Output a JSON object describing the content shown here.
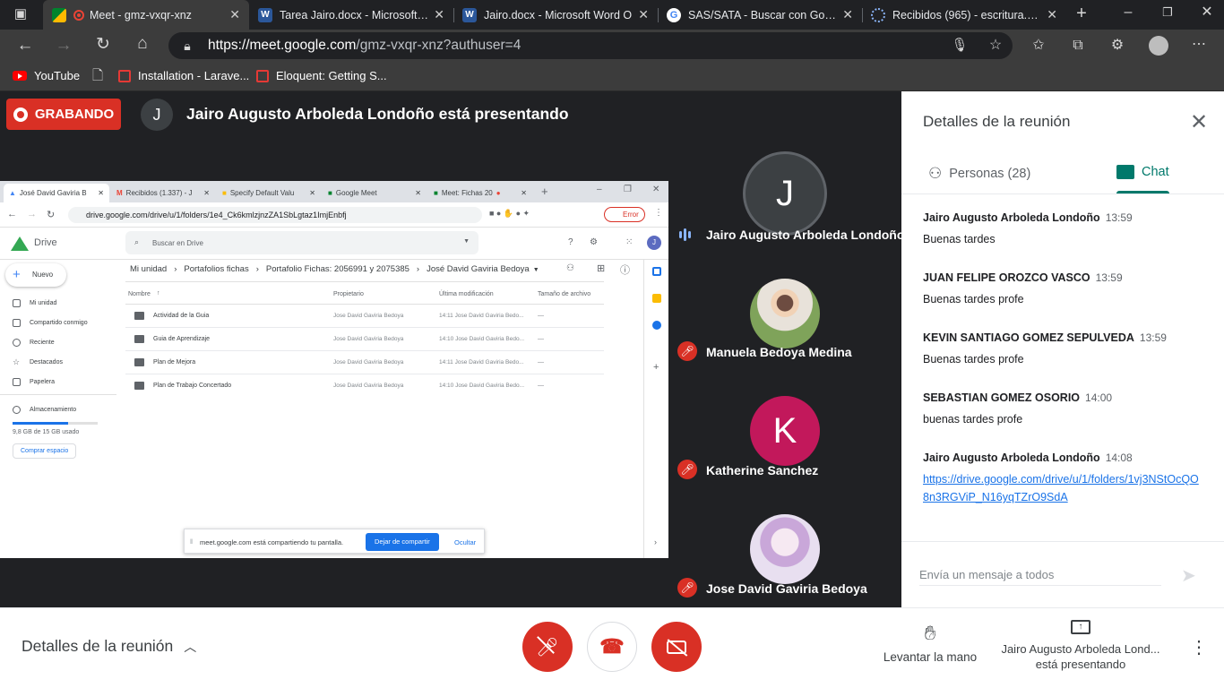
{
  "tabs": [
    {
      "title": "Meet - gmz-vxqr-xnz",
      "active": true
    },
    {
      "title": "Tarea Jairo.docx - Microsoft W",
      "active": false
    },
    {
      "title": "Jairo.docx - Microsoft Word O",
      "active": false
    },
    {
      "title": "SAS/SATA - Buscar con Google",
      "active": false
    },
    {
      "title": "Recibidos (965) - escritura.100",
      "active": false
    }
  ],
  "address": {
    "host": "https://meet.google.com",
    "path": "/gmz-vxqr-xnz?authuser=4"
  },
  "bookmarks": [
    "YouTube",
    "Installation - Larave...",
    "Eloquent: Getting S..."
  ],
  "recording": {
    "label": "GRABANDO"
  },
  "presenter": {
    "initial": "J",
    "banner": "Jairo Augusto Arboleda Londoño está presentando"
  },
  "shared_screen": {
    "tabs": [
      "José David Gaviria B",
      "Recibidos (1.337) - J",
      "Specify Default Valu",
      "Google Meet",
      "Meet: Fichas 20"
    ],
    "url": "drive.google.com/drive/u/1/folders/1e4_Ck6kmlzjnzZA1SbLgtaz1ImjEnbfj",
    "error_badge": "Error",
    "drive_title": "Drive",
    "search_placeholder": "Buscar en Drive",
    "new_button": "Nuevo",
    "nav": [
      "Mi unidad",
      "Compartido conmigo",
      "Reciente",
      "Destacados",
      "Papelera",
      "Almacenamiento"
    ],
    "storage_text": "9,8 GB de 15 GB usado",
    "buy_storage": "Comprar espacio",
    "breadcrumb": [
      "Mi unidad",
      "Portafolios fichas",
      "Portafolio Fichas: 2056991 y 2075385",
      "José David Gaviria Bedoya"
    ],
    "columns": [
      "Nombre",
      "Propietario",
      "Última modificación",
      "Tamaño de archivo"
    ],
    "rows": [
      {
        "name": "Actividad de la Guia",
        "owner": "Jose David Gaviria Bedoya",
        "modified": "14:11 Jose David Gaviria Bedo...",
        "size": "—"
      },
      {
        "name": "Guia de Aprendizaje",
        "owner": "Jose David Gaviria Bedoya",
        "modified": "14:10 Jose David Gaviria Bedo...",
        "size": "—"
      },
      {
        "name": "Plan de Mejora",
        "owner": "Jose David Gaviria Bedoya",
        "modified": "14:11 Jose David Gaviria Bedo...",
        "size": "—"
      },
      {
        "name": "Plan de Trabajo Concertado",
        "owner": "Jose David Gaviria Bedoya",
        "modified": "14:10 Jose David Gaviria Bedo...",
        "size": "—"
      }
    ],
    "share_bar": {
      "text": "meet.google.com está compartiendo tu pantalla.",
      "stop": "Dejar de compartir",
      "hide": "Ocultar"
    }
  },
  "participants": [
    {
      "name": "Jairo Augusto Arboleda Londoño",
      "initial": "J",
      "color": "#3c4043",
      "muted": false
    },
    {
      "name": "Manuela Bedoya Medina",
      "initial": "",
      "color": "#8fae6c",
      "muted": true
    },
    {
      "name": "Katherine Sanchez",
      "initial": "K",
      "color": "#c2185b",
      "muted": true
    },
    {
      "name": "Jose David Gaviria Bedoya",
      "initial": "",
      "color": "#d9c8e8",
      "muted": true
    }
  ],
  "panel": {
    "title": "Detalles de la reunión",
    "people_tab": "Personas (28)",
    "chat_tab": "Chat",
    "messages": [
      {
        "sender": "Jairo Augusto Arboleda Londoño",
        "time": "13:59",
        "text": "Buenas tardes"
      },
      {
        "sender": "JUAN FELIPE OROZCO VASCO",
        "time": "13:59",
        "text": "Buenas tardes profe"
      },
      {
        "sender": "KEVIN SANTIAGO GOMEZ SEPULVEDA",
        "time": "13:59",
        "text": "Buenas tardes profe"
      },
      {
        "sender": "SEBASTIAN GOMEZ OSORIO",
        "time": "14:00",
        "text": "buenas tardes profe"
      },
      {
        "sender": "Jairo Augusto Arboleda Londoño",
        "time": "14:08",
        "link": "https://drive.google.com/drive/u/1/folders/1vj3NStOcQO8n3RGViP_N16yqTZrO9SdA"
      }
    ],
    "input_placeholder": "Envía un mensaje a todos"
  },
  "bottom": {
    "details": "Detalles de la reunión",
    "raise_hand": "Levantar la mano",
    "presenting": "Jairo Augusto Arboleda Lond...",
    "presenting_sub": "está presentando"
  },
  "colors": {
    "danger": "#d93025",
    "accent": "#1a73e8",
    "meet_bg": "#202124",
    "chat_accent": "#00796b"
  }
}
